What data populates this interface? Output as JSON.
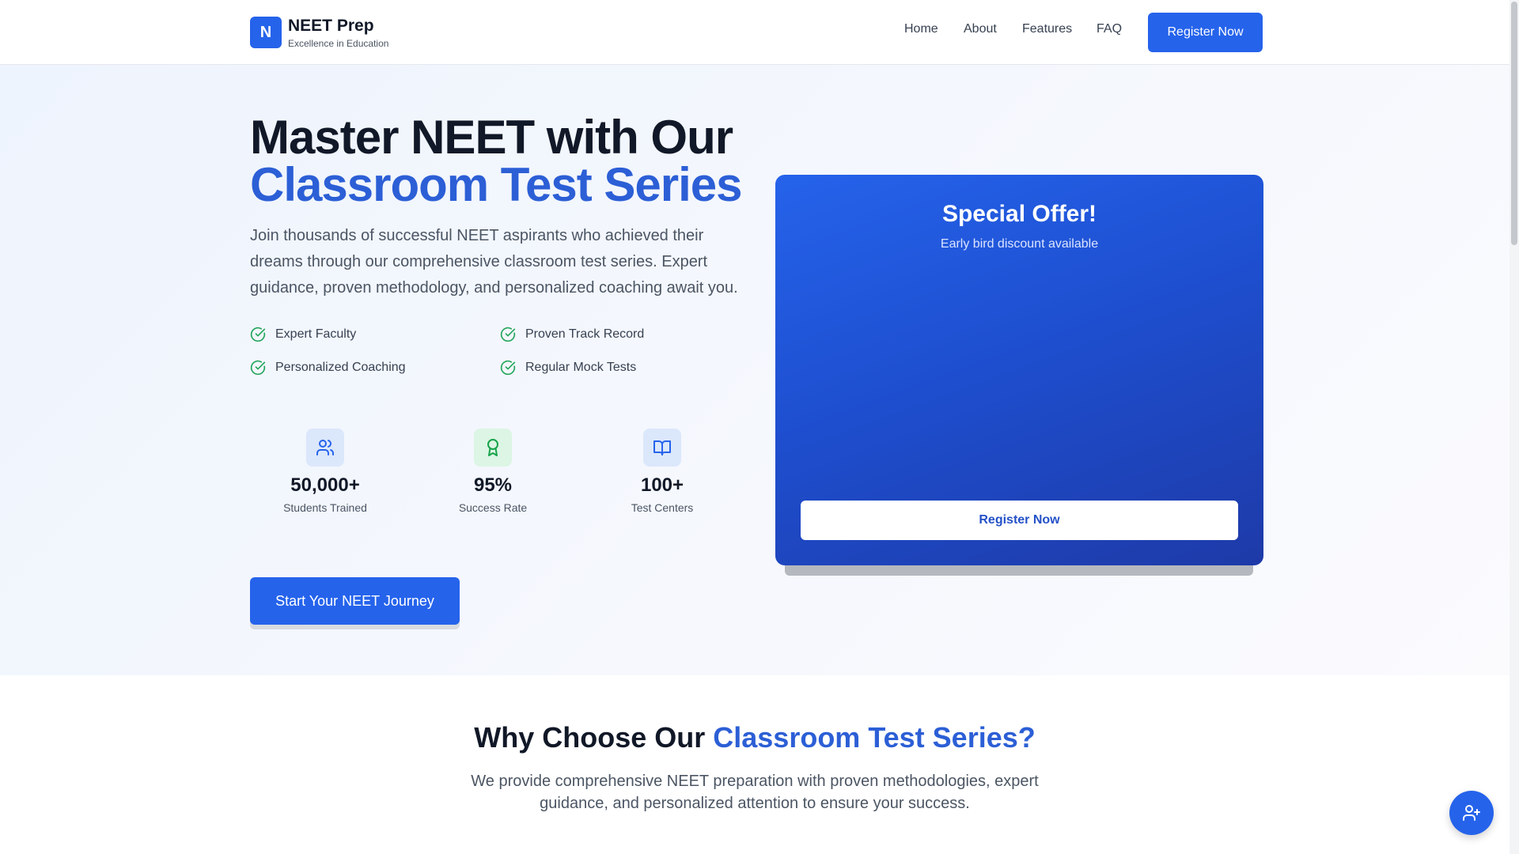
{
  "header": {
    "logo_letter": "N",
    "brand_name": "NEET Prep",
    "brand_tagline": "Excellence in Education",
    "nav": [
      "Home",
      "About",
      "Features",
      "FAQ"
    ],
    "cta_label": "Register Now"
  },
  "hero": {
    "title_line1": "Master NEET with Our",
    "title_line2": "Classroom Test Series",
    "description": "Join thousands of successful NEET aspirants who achieved their dreams through our comprehensive classroom test series. Expert guidance, proven methodology, and personalized coaching await you.",
    "features": [
      "Expert Faculty",
      "Proven Track Record",
      "Personalized Coaching",
      "Regular Mock Tests"
    ],
    "stats": [
      {
        "value": "50,000+",
        "label": "Students Trained",
        "icon": "users-icon"
      },
      {
        "value": "95%",
        "label": "Success Rate",
        "icon": "award-icon"
      },
      {
        "value": "100+",
        "label": "Test Centers",
        "icon": "book-open-icon"
      }
    ],
    "cta_label": "Start Your NEET Journey"
  },
  "offer": {
    "title": "Special Offer!",
    "subtitle": "Early bird discount available",
    "button_label": "Register Now"
  },
  "why": {
    "title_part1": "Why Choose Our ",
    "title_part2": "Classroom Test Series?",
    "description": "We provide comprehensive NEET preparation with proven methodologies, expert guidance, and personalized attention to ensure your success."
  },
  "colors": {
    "primary": "#2563eb",
    "accent_text": "#2c5fd6",
    "success": "#22a55a",
    "stat_icon_bg_blue": "#dbe7fb",
    "stat_icon_bg_green": "#dcf5e4"
  }
}
